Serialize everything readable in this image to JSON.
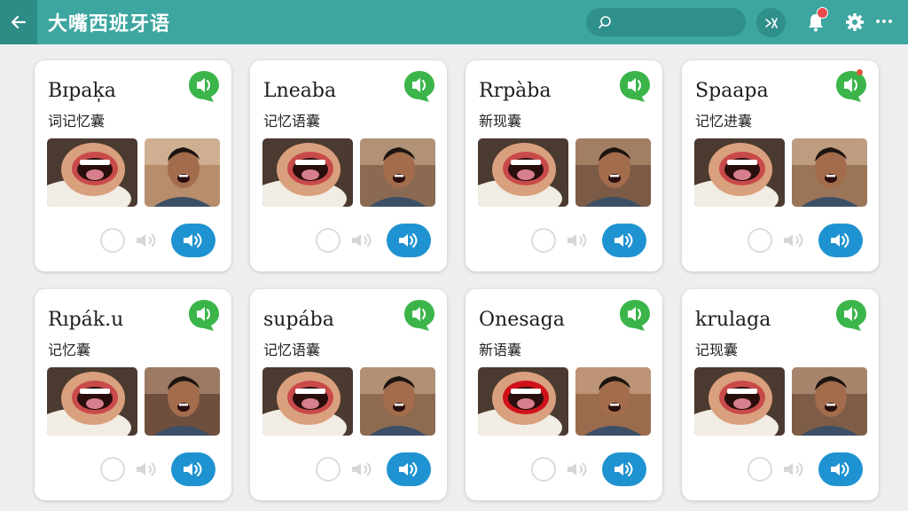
{
  "header": {
    "title": "大嘴西班牙语",
    "back_icon": "arrow-left-icon",
    "search_placeholder": "",
    "icons": [
      "search-icon",
      "shuffle-icon",
      "bell-icon",
      "gear-icon",
      "more-icon"
    ]
  },
  "colors": {
    "header": "#3ea6a0",
    "header_dark": "#2f8f8a",
    "bubble_green": "#3bb54a",
    "play_blue": "#1f93d1",
    "badge_red": "#e94b4b"
  },
  "cards": [
    {
      "word": "Bɪpak̩a",
      "subtitle": "词记忆囊"
    },
    {
      "word": "Lneaba",
      "subtitle": "记忆语囊"
    },
    {
      "word": "Rrpàba",
      "subtitle": "新现囊"
    },
    {
      "word": "Spaapa",
      "subtitle": "记忆进囊"
    },
    {
      "word": "Rıpák.u",
      "subtitle": "记忆囊"
    },
    {
      "word": "supába",
      "subtitle": "记忆语囊"
    },
    {
      "word": "Onesaga",
      "subtitle": "新语囊"
    },
    {
      "word": "krulaga",
      "subtitle": "记现囊"
    }
  ]
}
